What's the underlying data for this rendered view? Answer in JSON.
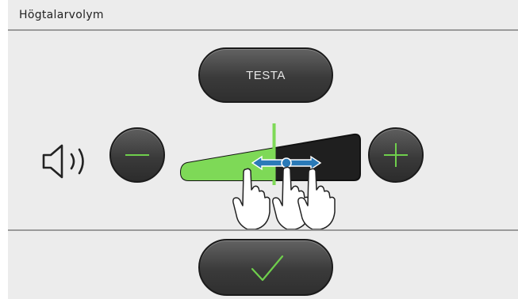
{
  "header": {
    "title": "Högtalarvolym"
  },
  "buttons": {
    "test_label": "TESTA"
  },
  "volume": {
    "level": 0.52,
    "accent": "#7ed957",
    "decrease_icon": "minus-icon",
    "increase_icon": "plus-icon",
    "speaker_icon": "speaker-icon"
  },
  "hint": {
    "gesture": "swipe-left-right-hand-icon"
  },
  "confirm": {
    "icon": "checkmark-icon"
  }
}
